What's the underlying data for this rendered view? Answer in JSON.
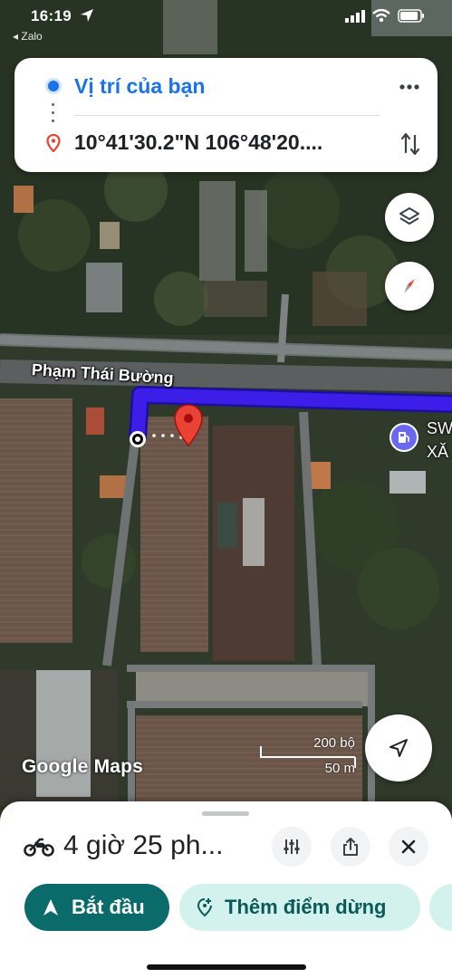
{
  "status_bar": {
    "time": "16:19",
    "back_app": "◂ Zalo"
  },
  "route": {
    "origin": "Vị trí của bạn",
    "destination": "10°41'30.2\"N 106°48'20...."
  },
  "map": {
    "road_label": "Phạm Thái Bường",
    "poi_label_line1": "SW",
    "poi_label_line2": "XĂ",
    "logo": "Google Maps",
    "scale_feet": "200 bộ",
    "scale_meters": "50 m",
    "route_color": "#3d1ee8"
  },
  "directions": {
    "duration": "4 giờ 25 ph...",
    "mode_icon": "motorcycle-icon",
    "start_label": "Bắt đầu",
    "add_stop_label": "Thêm điểm dừng"
  },
  "colors": {
    "primary_teal": "#0b6b6b",
    "chip_bg": "#d3f2ee",
    "origin_blue": "#1a73e8",
    "pin_red": "#ea4335"
  }
}
